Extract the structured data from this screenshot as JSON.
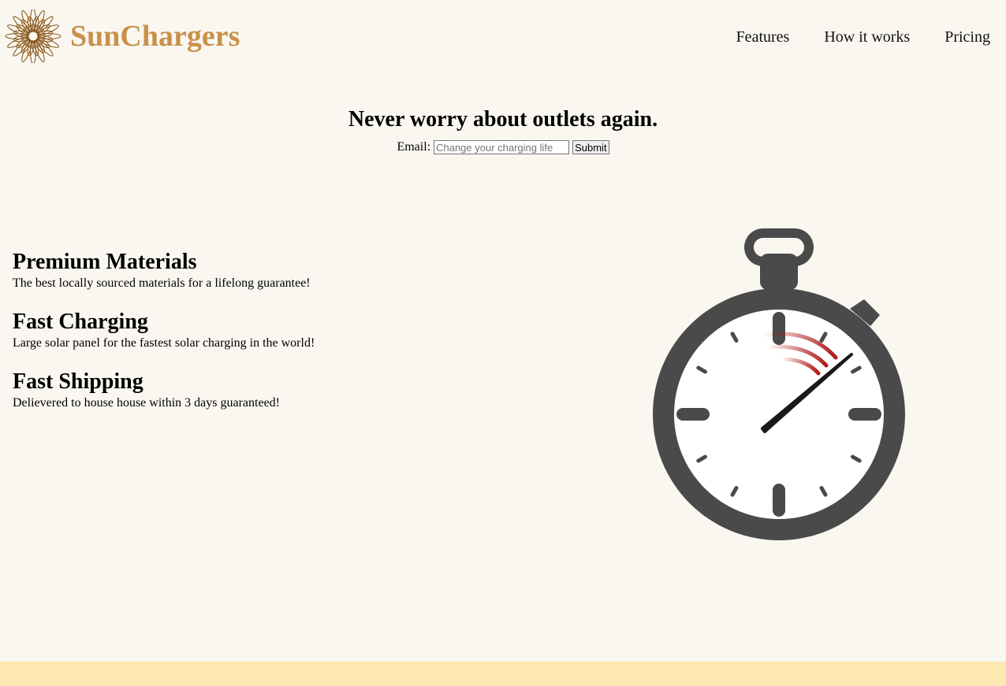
{
  "brand": {
    "name": "SunChargers",
    "color": "#c8914a"
  },
  "nav": {
    "items": [
      {
        "label": "Features"
      },
      {
        "label": "How it works"
      },
      {
        "label": "Pricing"
      }
    ]
  },
  "hero": {
    "title": "Never worry about outlets again.",
    "email_label": "Email:",
    "email_placeholder": "Change your charging life",
    "submit_label": "Submit"
  },
  "features": [
    {
      "title": "Premium Materials",
      "description": "The best locally sourced materials for a lifelong guarantee!"
    },
    {
      "title": "Fast Charging",
      "description": "Large solar panel for the fastest solar charging in the world!"
    },
    {
      "title": "Fast Shipping",
      "description": "Delievered to house house within 3 days guaranteed!"
    }
  ],
  "illustration": {
    "icon": "stopwatch-icon",
    "body_color": "#4a4a4a",
    "accent_color": "#b01717"
  },
  "footer": {
    "color": "#fde8b2"
  }
}
